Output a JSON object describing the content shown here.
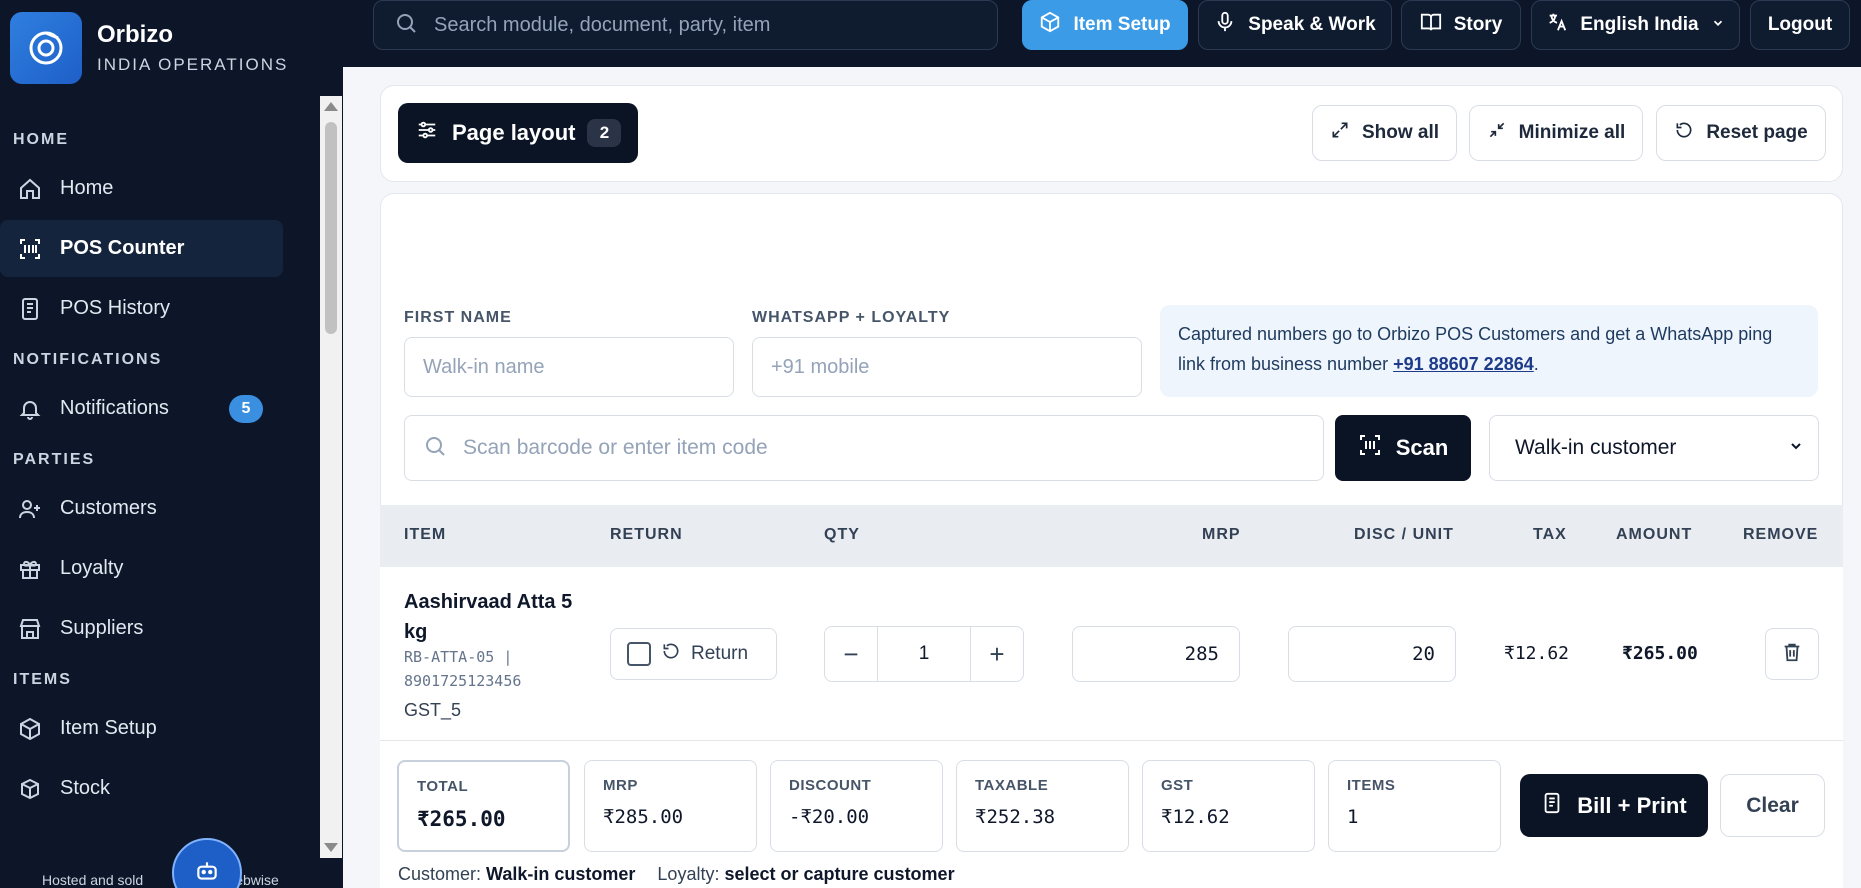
{
  "brand": {
    "name": "Orbizo",
    "subtitle": "INDIA OPERATIONS"
  },
  "sidebar": {
    "sections": [
      {
        "title": "HOME",
        "items": [
          {
            "label": "Home",
            "icon": "home-icon"
          },
          {
            "label": "POS Counter",
            "icon": "scan-icon",
            "active": true
          },
          {
            "label": "POS History",
            "icon": "receipt-icon"
          }
        ]
      },
      {
        "title": "NOTIFICATIONS",
        "items": [
          {
            "label": "Notifications",
            "icon": "bell-icon",
            "badge": "5"
          }
        ]
      },
      {
        "title": "PARTIES",
        "items": [
          {
            "label": "Customers",
            "icon": "user-plus-icon"
          },
          {
            "label": "Loyalty",
            "icon": "gift-icon"
          },
          {
            "label": "Suppliers",
            "icon": "store-icon"
          }
        ]
      },
      {
        "title": "ITEMS",
        "items": [
          {
            "label": "Item Setup",
            "icon": "package-icon"
          },
          {
            "label": "Stock",
            "icon": "boxes-icon"
          }
        ]
      }
    ],
    "footer": "Hosted and sold",
    "footer_tail": "ebwise"
  },
  "topbar": {
    "search_placeholder": "Search module, document, party, item",
    "item_setup": "Item Setup",
    "speak_work": "Speak & Work",
    "story": "Story",
    "language": "English India",
    "logout": "Logout"
  },
  "layout_bar": {
    "page_layout": "Page layout",
    "count": "2",
    "show_all": "Show all",
    "minimize_all": "Minimize all",
    "reset_page": "Reset page"
  },
  "customer_form": {
    "first_name_label": "FIRST NAME",
    "first_name_placeholder": "Walk-in name",
    "whatsapp_label": "WHATSAPP + LOYALTY",
    "whatsapp_placeholder": "+91 mobile",
    "info_text": "Captured numbers go to Orbizo POS Customers and get a WhatsApp ping link from business number ",
    "info_number": "+91 88607 22864",
    "info_end": "."
  },
  "scan": {
    "placeholder": "Scan barcode or enter item code",
    "button": "Scan",
    "customer_select": "Walk-in customer"
  },
  "table": {
    "headers": [
      "ITEM",
      "RETURN",
      "QTY",
      "MRP",
      "DISC / UNIT",
      "TAX",
      "AMOUNT",
      "REMOVE"
    ],
    "rows": [
      {
        "name": "Aashirvaad Atta 5 kg",
        "code": "RB-ATTA-05 | 8901725123456",
        "tax_class": "GST_5",
        "return_label": "Return",
        "qty": "1",
        "mrp": "285",
        "disc": "20",
        "tax": "₹12.62",
        "amount": "₹265.00"
      }
    ]
  },
  "totals": {
    "total_label": "TOTAL",
    "total": "₹265.00",
    "mrp_label": "MRP",
    "mrp": "₹285.00",
    "discount_label": "DISCOUNT",
    "discount": "-₹20.00",
    "taxable_label": "TAXABLE",
    "taxable": "₹252.38",
    "gst_label": "GST",
    "gst": "₹12.62",
    "items_label": "ITEMS",
    "items": "1",
    "bill_print": "Bill + Print",
    "clear": "Clear"
  },
  "status": {
    "customer_label": "Customer:",
    "customer": "Walk-in customer",
    "loyalty_label": "Loyalty:",
    "loyalty": "select or capture customer"
  },
  "colors": {
    "sidebar_bg": "#0c1628",
    "accent": "#3b9be6",
    "dark_button": "#0b1424"
  }
}
